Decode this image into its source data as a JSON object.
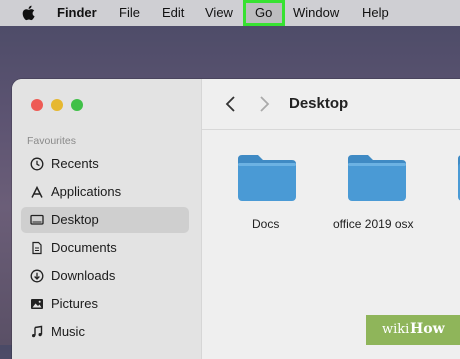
{
  "menubar": {
    "apple_icon": "apple-logo-icon",
    "items": [
      "Finder",
      "File",
      "Edit",
      "View",
      "Go",
      "Window",
      "Help"
    ],
    "highlighted": "Go",
    "highlight_color": "#37e231"
  },
  "window": {
    "traffic_lights": {
      "close": "#ee5b55",
      "minimize": "#e6b830",
      "zoom": "#40c048"
    },
    "toolbar": {
      "back_icon": "chevron-left-icon",
      "forward_icon": "chevron-right-icon",
      "title": "Desktop"
    },
    "sidebar": {
      "section_title": "Favourites",
      "items": [
        {
          "label": "Recents",
          "icon": "clock-icon",
          "selected": false
        },
        {
          "label": "Applications",
          "icon": "applications-icon",
          "selected": false
        },
        {
          "label": "Desktop",
          "icon": "desktop-icon",
          "selected": true
        },
        {
          "label": "Documents",
          "icon": "document-icon",
          "selected": false
        },
        {
          "label": "Downloads",
          "icon": "download-icon",
          "selected": false
        },
        {
          "label": "Pictures",
          "icon": "pictures-icon",
          "selected": false
        },
        {
          "label": "Music",
          "icon": "music-icon",
          "selected": false
        }
      ]
    },
    "files": [
      {
        "name": "Docs",
        "icon": "folder-icon"
      },
      {
        "name": "office 2019 osx",
        "icon": "folder-icon"
      }
    ],
    "folder_color": "#4a9ad5"
  },
  "watermark": {
    "part1": "wiki",
    "part2": "How"
  }
}
